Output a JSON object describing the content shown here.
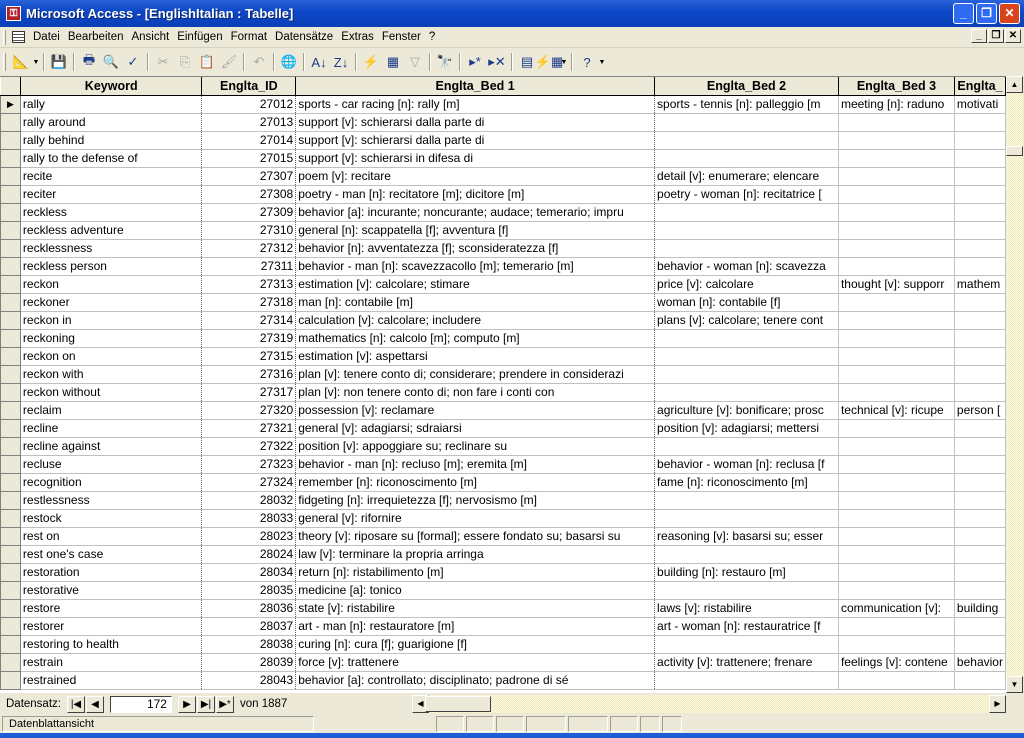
{
  "window": {
    "title": "Microsoft Access - [EnglishItalian : Tabelle]",
    "app_icon": "key-icon",
    "controls": [
      "minimize",
      "restore",
      "close"
    ]
  },
  "menubar": {
    "items": [
      "Datei",
      "Bearbeiten",
      "Ansicht",
      "Einfügen",
      "Format",
      "Datensätze",
      "Extras",
      "Fenster",
      "?"
    ]
  },
  "toolbar": {
    "buttons": [
      {
        "name": "view-icon",
        "glyph": "📐",
        "enabled": true,
        "dropdown": true
      },
      {
        "name": "save-icon",
        "glyph": "💾",
        "enabled": true
      },
      {
        "name": "print-icon",
        "glyph": "🖶",
        "enabled": true
      },
      {
        "name": "print-preview-icon",
        "glyph": "🔍",
        "enabled": true
      },
      {
        "name": "spelling-icon",
        "glyph": "✓",
        "enabled": true
      },
      {
        "name": "cut-icon",
        "glyph": "✂",
        "enabled": false
      },
      {
        "name": "copy-icon",
        "glyph": "⎘",
        "enabled": false
      },
      {
        "name": "paste-icon",
        "glyph": "📋",
        "enabled": false
      },
      {
        "name": "format-painter-icon",
        "glyph": "🖌",
        "enabled": false
      },
      {
        "name": "undo-icon",
        "glyph": "↶",
        "enabled": false
      },
      {
        "name": "insert-hyperlink-icon",
        "glyph": "🌐",
        "enabled": false
      },
      {
        "name": "sort-ascending-icon",
        "glyph": "A↓",
        "enabled": true
      },
      {
        "name": "sort-descending-icon",
        "glyph": "Z↓",
        "enabled": true
      },
      {
        "name": "filter-by-selection-icon",
        "glyph": "⚡",
        "enabled": true
      },
      {
        "name": "filter-by-form-icon",
        "glyph": "▦",
        "enabled": true
      },
      {
        "name": "apply-filter-icon",
        "glyph": "▽",
        "enabled": false
      },
      {
        "name": "find-icon",
        "glyph": "🔭",
        "enabled": true
      },
      {
        "name": "new-record-icon",
        "glyph": "▸*",
        "enabled": true
      },
      {
        "name": "delete-record-icon",
        "glyph": "▸✕",
        "enabled": true
      },
      {
        "name": "database-window-icon",
        "glyph": "▤",
        "enabled": true
      },
      {
        "name": "new-object-icon",
        "glyph": "⚡▦",
        "enabled": true,
        "dropdown": true
      },
      {
        "name": "help-icon",
        "glyph": "?",
        "enabled": true,
        "dropdown": true
      }
    ]
  },
  "table": {
    "columns": [
      "Keyword",
      "Englta_ID",
      "Englta_Bed 1",
      "Englta_Bed 2",
      "Englta_Bed 3",
      "Englta_"
    ],
    "current_row_index": 0,
    "rows": [
      [
        "rally",
        "27012",
        "sports - car racing [n]: rally [m]",
        "sports - tennis [n]: palleggio [m",
        "meeting [n]: raduno",
        "motivati"
      ],
      [
        "rally around",
        "27013",
        "support [v]: schierarsi dalla parte di",
        "",
        "",
        ""
      ],
      [
        "rally behind",
        "27014",
        "support [v]: schierarsi dalla parte di",
        "",
        "",
        ""
      ],
      [
        "rally to the defense of",
        "27015",
        "support [v]: schierarsi in difesa di",
        "",
        "",
        ""
      ],
      [
        "recite",
        "27307",
        "poem [v]: recitare",
        "detail [v]: enumerare; elencare",
        "",
        ""
      ],
      [
        "reciter",
        "27308",
        "poetry - man [n]: recitatore [m]; dicitore [m]",
        "poetry - woman [n]: recitatrice [",
        "",
        ""
      ],
      [
        "reckless",
        "27309",
        "behavior [a]: incurante; noncurante; audace; temerario; impru",
        "",
        "",
        ""
      ],
      [
        "reckless adventure",
        "27310",
        "general [n]: scappatella [f]; avventura [f]",
        "",
        "",
        ""
      ],
      [
        "recklessness",
        "27312",
        "behavior [n]: avventatezza [f]; sconsideratezza [f]",
        "",
        "",
        ""
      ],
      [
        "reckless person",
        "27311",
        "behavior - man [n]: scavezzacollo [m]; temerario [m]",
        "behavior - woman [n]: scavezza",
        "",
        ""
      ],
      [
        "reckon",
        "27313",
        "estimation [v]: calcolare; stimare",
        "price [v]: calcolare",
        "thought [v]: supporr",
        "mathem"
      ],
      [
        "reckoner",
        "27318",
        "man [n]: contabile [m]",
        "woman [n]: contabile [f]",
        "",
        ""
      ],
      [
        "reckon in",
        "27314",
        "calculation [v]: calcolare; includere",
        "plans [v]: calcolare; tenere cont",
        "",
        ""
      ],
      [
        "reckoning",
        "27319",
        "mathematics [n]: calcolo [m]; computo [m]",
        "",
        "",
        ""
      ],
      [
        "reckon on",
        "27315",
        "estimation [v]: aspettarsi",
        "",
        "",
        ""
      ],
      [
        "reckon with",
        "27316",
        "plan [v]: tenere conto di; considerare; prendere in considerazi",
        "",
        "",
        ""
      ],
      [
        "reckon without",
        "27317",
        "plan [v]: non tenere conto di; non fare i conti con",
        "",
        "",
        ""
      ],
      [
        "reclaim",
        "27320",
        "possession [v]: reclamare",
        "agriculture [v]: bonificare; prosc",
        "technical [v]: ricupe",
        "person ["
      ],
      [
        "recline",
        "27321",
        "general [v]: adagiarsi; sdraiarsi",
        "position [v]: adagiarsi; mettersi",
        "",
        ""
      ],
      [
        "recline against",
        "27322",
        "position [v]: appoggiare su; reclinare su",
        "",
        "",
        ""
      ],
      [
        "recluse",
        "27323",
        "behavior - man [n]: recluso [m]; eremita [m]",
        "behavior - woman [n]: reclusa [f",
        "",
        ""
      ],
      [
        "recognition",
        "27324",
        "remember [n]: riconoscimento [m]",
        "fame [n]: riconoscimento [m]",
        "",
        ""
      ],
      [
        "restlessness",
        "28032",
        "fidgeting [n]: irrequietezza [f]; nervosismo [m]",
        "",
        "",
        ""
      ],
      [
        "restock",
        "28033",
        "general [v]: rifornire",
        "",
        "",
        ""
      ],
      [
        "rest on",
        "28023",
        "theory [v]: riposare su [formal]; essere fondato su; basarsi su",
        "reasoning [v]: basarsi su; esser",
        "",
        ""
      ],
      [
        "rest one's case",
        "28024",
        "law [v]: terminare la propria arringa",
        "",
        "",
        ""
      ],
      [
        "restoration",
        "28034",
        "return [n]: ristabilimento [m]",
        "building [n]: restauro [m]",
        "",
        ""
      ],
      [
        "restorative",
        "28035",
        "medicine [a]: tonico",
        "",
        "",
        ""
      ],
      [
        "restore",
        "28036",
        "state [v]: ristabilire",
        "laws [v]: ristabilire",
        "communication [v]:",
        "building"
      ],
      [
        "restorer",
        "28037",
        "art - man [n]: restauratore [m]",
        "art - woman [n]: restauratrice [f",
        "",
        ""
      ],
      [
        "restoring to health",
        "28038",
        "curing [n]: cura [f]; guarigione [f]",
        "",
        "",
        ""
      ],
      [
        "restrain",
        "28039",
        "force [v]: trattenere",
        "activity [v]: trattenere; frenare",
        "feelings [v]: contene",
        "behavior"
      ],
      [
        "restrained",
        "28043",
        "behavior [a]: controllato; disciplinato; padrone di sé",
        "",
        "",
        ""
      ]
    ]
  },
  "navigation": {
    "label": "Datensatz:",
    "current_record": "172",
    "total_label": "von 1887",
    "buttons": [
      "first-record",
      "previous-record",
      "next-record",
      "last-record",
      "new-record"
    ]
  },
  "statusbar": {
    "text": "Datenblattansicht"
  }
}
